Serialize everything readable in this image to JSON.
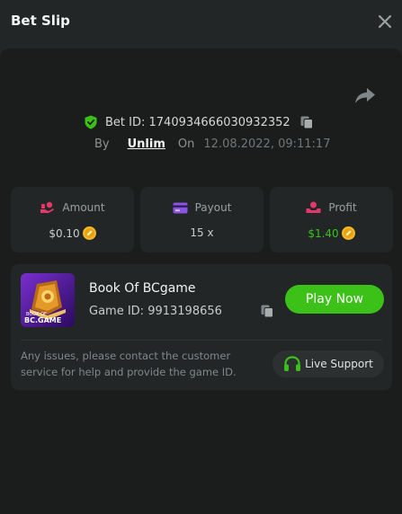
{
  "header": {
    "title": "Bet Slip"
  },
  "bet": {
    "id_text": "Bet ID: 1740934666030932352",
    "by_label": "By",
    "user": "Unlim",
    "on_label": "On",
    "datetime": "12.08.2022, 09:11:17"
  },
  "stats": {
    "amount": {
      "label": "Amount",
      "value": "$0.10"
    },
    "payout": {
      "label": "Payout",
      "value": "15 x"
    },
    "profit": {
      "label": "Profit",
      "value": "$1.40"
    }
  },
  "game": {
    "thumbnail_text_top": "BOOK OF",
    "thumbnail_text_bottom": "BC.GAME",
    "name": "Book Of BCgame",
    "id_text": "Game ID: 9913198656",
    "play_label": "Play Now"
  },
  "support": {
    "issue_text": "Any issues, please contact the customer service for help and provide the game ID.",
    "button_label": "Live Support"
  },
  "colors": {
    "accent_green": "#3bc117",
    "profit_green": "#3bc117",
    "background": "#232626",
    "panel": "#1b1d1d"
  },
  "icons": [
    "close-icon",
    "share-icon",
    "shield-check-icon",
    "copy-icon",
    "amount-icon",
    "payout-icon",
    "profit-icon",
    "coin-icon",
    "headset-icon"
  ]
}
